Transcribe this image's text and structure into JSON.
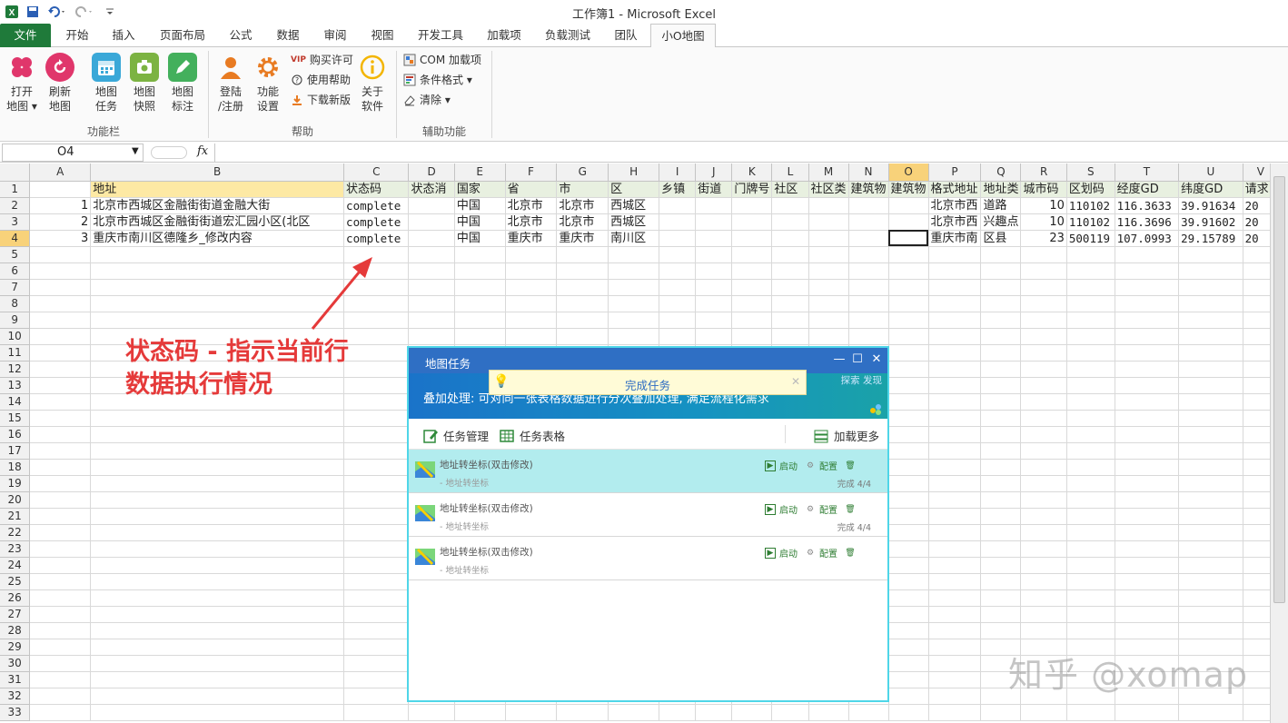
{
  "window": {
    "title": "工作簿1 - Microsoft Excel"
  },
  "tabs": [
    "文件",
    "开始",
    "插入",
    "页面布局",
    "公式",
    "数据",
    "审阅",
    "视图",
    "开发工具",
    "加载项",
    "负载测试",
    "团队",
    "小O地图"
  ],
  "ribbon": {
    "group1": {
      "label": "功能栏",
      "buttons": [
        {
          "label": "打开\n地图 ▾",
          "icon": "flower-icon",
          "color": "#e0366b"
        },
        {
          "label": "刷新\n地图",
          "icon": "refresh-icon",
          "color": "#e0366b"
        },
        {
          "label": "地图\n任务",
          "icon": "calendar-icon",
          "color": "#3aa8d8"
        },
        {
          "label": "地图\n快照",
          "icon": "camera-icon",
          "color": "#7cb342"
        },
        {
          "label": "地图\n标注",
          "icon": "pencil-icon",
          "color": "#43b05c"
        }
      ]
    },
    "group2": {
      "label": "帮助",
      "buttons": [
        {
          "label": "登陆\n/注册",
          "icon": "user-icon",
          "color": "#e87b22"
        },
        {
          "label": "功能\n设置",
          "icon": "gear-icon",
          "color": "#e87b22"
        },
        {
          "label": "关于\n软件",
          "icon": "info-icon",
          "color": "#f3b500"
        }
      ],
      "small": [
        {
          "label": "购买许可",
          "badge": "VIP"
        },
        {
          "label": "使用帮助",
          "icon": "help-icon"
        },
        {
          "label": "下载新版",
          "icon": "download-icon"
        }
      ]
    },
    "group3": {
      "label": "辅助功能",
      "small": [
        {
          "label": "COM 加载项"
        },
        {
          "label": "条件格式 ▾"
        },
        {
          "label": "清除 ▾"
        }
      ]
    }
  },
  "formula_bar": {
    "name_box": "O4",
    "fx": "fx"
  },
  "grid": {
    "columns": [
      "A",
      "B",
      "C",
      "D",
      "E",
      "F",
      "G",
      "H",
      "I",
      "J",
      "K",
      "L",
      "M",
      "N",
      "O",
      "P",
      "Q",
      "R",
      "S",
      "T",
      "U",
      "V"
    ],
    "row1": [
      "",
      "地址",
      "状态码",
      "状态消",
      "国家",
      "省",
      "市",
      "区",
      "乡镇",
      "街道",
      "门牌号",
      "社区",
      "社区类",
      "建筑物",
      "建筑物",
      "格式地址",
      "地址类",
      "城市码",
      "区划码",
      "经度GD",
      "纬度GD",
      "请求"
    ],
    "row2": [
      "1",
      "北京市西城区金融街街道金融大街",
      "complete",
      "",
      "中国",
      "北京市",
      "北京市",
      "西城区",
      "",
      "",
      "",
      "",
      "",
      "",
      "",
      "北京市西",
      "道路",
      "10",
      "110102",
      "116.3633",
      "39.91634",
      "20"
    ],
    "row3": [
      "2",
      "北京市西城区金融街街道宏汇园小区(北区",
      "complete",
      "",
      "中国",
      "北京市",
      "北京市",
      "西城区",
      "",
      "",
      "",
      "",
      "",
      "",
      "",
      "北京市西",
      "兴趣点",
      "10",
      "110102",
      "116.3696",
      "39.91602",
      "20"
    ],
    "row4": [
      "3",
      "重庆市南川区德隆乡_修改内容",
      "complete",
      "",
      "中国",
      "重庆市",
      "重庆市",
      "南川区",
      "",
      "",
      "",
      "",
      "",
      "",
      "",
      "重庆市南",
      "区县",
      "23",
      "500119",
      "107.0993",
      "29.15789",
      "20"
    ],
    "row_count": 33
  },
  "annotation": {
    "line1": "状态码 - 指示当前行",
    "line2": "数据执行情况"
  },
  "watermark": "知乎 @xomap",
  "dialog": {
    "title": "地图任务",
    "banner_text": "叠加处理: 可对同一张表格数据进行分次叠加处理, 满足流程化需求",
    "banner_links": "探索 发现",
    "toast": "完成任务",
    "toolbar": {
      "manage": "任务管理",
      "table": "任务表格",
      "more": "加载更多"
    },
    "tasks": [
      {
        "name": "地址转坐标(双击修改)",
        "sub": "- 地址转坐标",
        "start": "启动",
        "config": "配置",
        "progress": "完成 4/4",
        "selected": true
      },
      {
        "name": "地址转坐标(双击修改)",
        "sub": "- 地址转坐标",
        "start": "启动",
        "config": "配置",
        "progress": "完成 4/4",
        "selected": false
      },
      {
        "name": "地址转坐标(双击修改)",
        "sub": "- 地址转坐标",
        "start": "启动",
        "config": "配置",
        "progress": "",
        "selected": false
      }
    ]
  },
  "colors": {
    "file_tab": "#1f7a3a",
    "dialog_title": "#2f6fc4",
    "dialog_border": "#4fd6e8",
    "annotation": "#e53a3a",
    "selected_task": "#b2ecee"
  }
}
